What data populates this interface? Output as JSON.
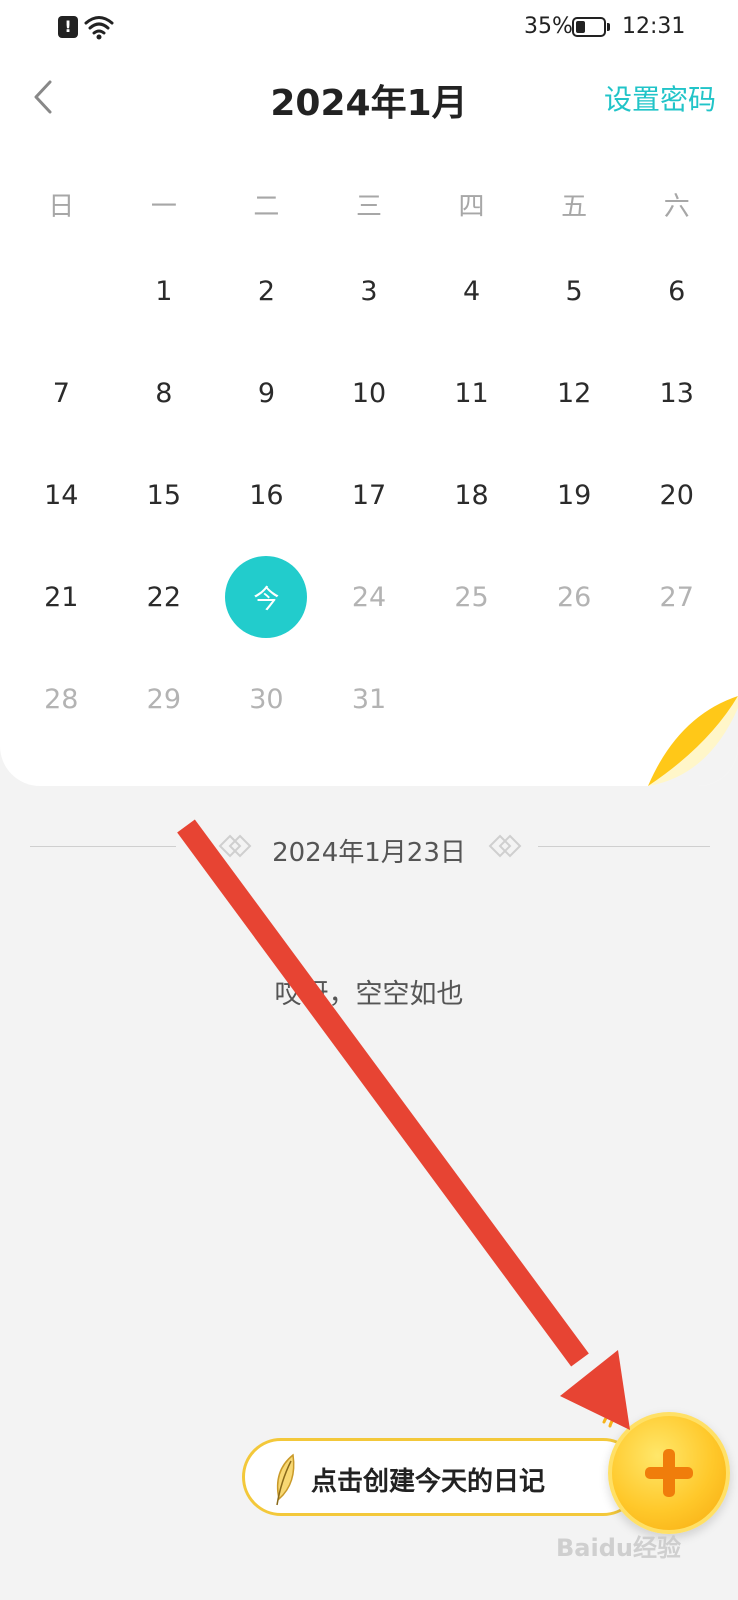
{
  "status_bar": {
    "alert": "!",
    "battery_percent": "35%",
    "battery_level": 0.35,
    "time": "12:31"
  },
  "header": {
    "title": "2024年1月",
    "right_action": "设置密码",
    "back_icon": "chevron-left-icon"
  },
  "calendar": {
    "weekdays": [
      "日",
      "一",
      "二",
      "三",
      "四",
      "五",
      "六"
    ],
    "today_label": "今",
    "weeks": [
      [
        "",
        "1",
        "2",
        "3",
        "4",
        "5",
        "6"
      ],
      [
        "7",
        "8",
        "9",
        "10",
        "11",
        "12",
        "13"
      ],
      [
        "14",
        "15",
        "16",
        "17",
        "18",
        "19",
        "20"
      ],
      [
        "21",
        "22",
        "今",
        "24",
        "25",
        "26",
        "27"
      ],
      [
        "28",
        "29",
        "30",
        "31",
        "",
        "",
        ""
      ]
    ],
    "today_day": 23
  },
  "selected_date": "2024年1月23日",
  "empty_message": "哎呀，空空如也",
  "create_button": {
    "label": "点击创建今天的日记",
    "icon": "feather-icon",
    "fab_icon": "plus-icon"
  },
  "colors": {
    "accent": "#21c4c8",
    "today_circle": "#22cccc",
    "fab": "#ffc82a",
    "arrow": "#e74433"
  },
  "watermark": "Baidu经验"
}
